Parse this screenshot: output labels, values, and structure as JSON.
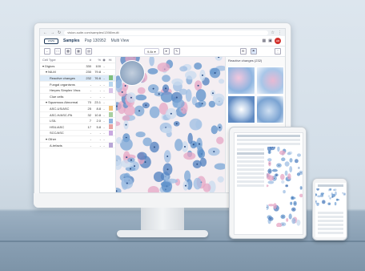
{
  "browser": {
    "url": "vision-suite.com/samples/1398/multi",
    "nav_icons": [
      "back-icon",
      "forward-icon",
      "reload-icon",
      "lock-icon"
    ]
  },
  "app": {
    "logo_text": "WWW",
    "nav_label": "Samples",
    "breadcrumb_sample": "Pap 130952",
    "breadcrumb_view": "Multi View",
    "avatar_initials": "HR"
  },
  "toolbar": {
    "zoom_label": "9.8x ▾"
  },
  "panel": {
    "headers": {
      "type": "Cell Type",
      "count": "#",
      "percent": "%",
      "eye": "◉",
      "color": "Hi"
    },
    "rows": [
      {
        "label": "▾ Digicrs",
        "count": "330",
        "percent": "100",
        "eye": "-",
        "indent": 0,
        "selected": false,
        "swatch": ""
      },
      {
        "label": "▾ NILM",
        "count": "230",
        "percent": "79.8",
        "eye": "-",
        "indent": 1,
        "selected": false,
        "swatch": ""
      },
      {
        "label": "Reactive changes",
        "count": "232",
        "percent": "76.6",
        "eye": "-",
        "indent": 2,
        "selected": true,
        "swatch": "#7fbf7f"
      },
      {
        "label": "Fungal organisms",
        "count": "-",
        "percent": "-",
        "eye": "-",
        "indent": 2,
        "selected": false,
        "swatch": "#b9d7ef"
      },
      {
        "label": "Herpes Simplex Virus",
        "count": "-",
        "percent": "-",
        "eye": "-",
        "indent": 2,
        "selected": false,
        "swatch": "#d9c3e8"
      },
      {
        "label": "Clue cells",
        "count": "-",
        "percent": "-",
        "eye": "-",
        "indent": 2,
        "selected": false,
        "swatch": ""
      },
      {
        "label": "▾ Squamous Abnormal",
        "count": "70",
        "percent": "23.1",
        "eye": "-",
        "indent": 1,
        "selected": false,
        "swatch": ""
      },
      {
        "label": "ASC-US/ASC",
        "count": "25",
        "percent": "8.8",
        "eye": "-",
        "indent": 2,
        "selected": false,
        "swatch": "#f2c27a"
      },
      {
        "label": "ASC-H/ASC-PA",
        "count": "32",
        "percent": "10.8",
        "eye": "-",
        "indent": 2,
        "selected": false,
        "swatch": "#a9d0a0"
      },
      {
        "label": "LSIL",
        "count": "7",
        "percent": "2.0",
        "eye": "-",
        "indent": 2,
        "selected": false,
        "swatch": "#8fb3e0"
      },
      {
        "label": "HSIL/ASC",
        "count": "17",
        "percent": "5.8",
        "eye": "-",
        "indent": 2,
        "selected": false,
        "swatch": "#e7a3a3"
      },
      {
        "label": "SCC/ASC",
        "count": "-",
        "percent": "-",
        "eye": "-",
        "indent": 2,
        "selected": false,
        "swatch": "#c9a8e0"
      },
      {
        "label": "▾ Other",
        "count": "-",
        "percent": "-",
        "eye": "-",
        "indent": 1,
        "selected": false,
        "swatch": ""
      },
      {
        "label": "A-tefacts",
        "count": "-",
        "percent": "-",
        "eye": "-",
        "indent": 2,
        "selected": false,
        "swatch": "#b8a6d6"
      }
    ]
  },
  "gallery": {
    "title": "Reactive changes (232)"
  },
  "colors": {
    "brand": "#1f3a5a",
    "selected_row": "#dceaf8",
    "avatar": "#d2322d",
    "cell_blue": "#5b8fc9",
    "cell_pink": "#e6a6c4"
  }
}
